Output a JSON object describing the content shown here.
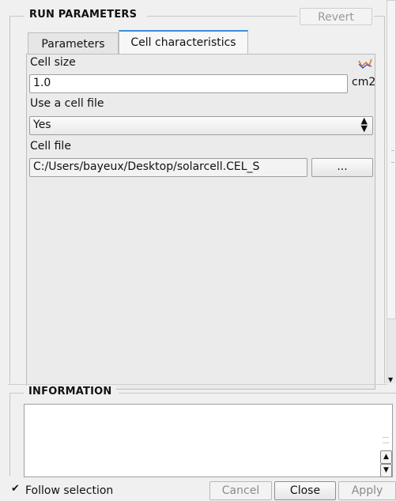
{
  "run_parameters": {
    "title": "RUN PARAMETERS",
    "revert_label": "Revert"
  },
  "tabs": [
    {
      "label": "Parameters",
      "active": false
    },
    {
      "label": "Cell characteristics",
      "active": true
    }
  ],
  "cell_characteristics": {
    "cell_size_label": "Cell size",
    "cell_size_value": "1.0",
    "cell_size_unit": "cm2",
    "use_cell_file_label": "Use a cell file",
    "use_cell_file_value": "Yes",
    "cell_file_label": "Cell file",
    "cell_file_value": "C:/Users/bayeux/Desktop/solarcell.CEL_S",
    "browse_label": "...",
    "graph_icon": "line-graph-icon"
  },
  "information": {
    "title": "INFORMATION",
    "text": ""
  },
  "footer": {
    "follow_selection_label": "Follow selection",
    "follow_selection_checked": true,
    "cancel_label": "Cancel",
    "close_label": "Close",
    "apply_label": "Apply"
  },
  "colors": {
    "tab_accent": "#3c8dd9",
    "graph_icon_color": "#e07a1f",
    "graph_icon_color2": "#3b5bd6"
  }
}
